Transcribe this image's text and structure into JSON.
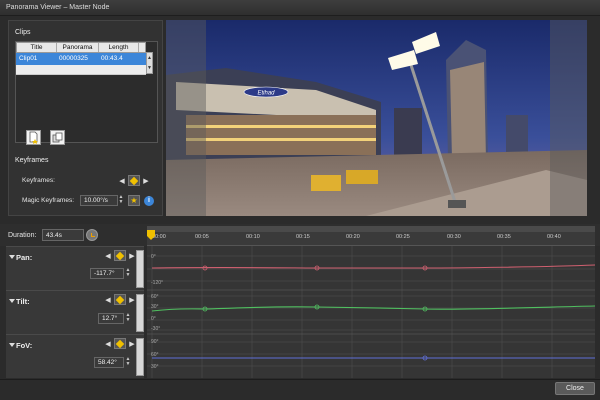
{
  "window": {
    "title": "Panorama Viewer – Master Node"
  },
  "clips": {
    "section_title": "Clips",
    "columns": [
      "Title",
      "Panorama",
      "Length"
    ],
    "rows": [
      {
        "title": "Clip01",
        "panorama": "00000325",
        "length": "00:43.4"
      }
    ]
  },
  "keyframes": {
    "section_title": "Keyframes",
    "keyframes_label": "Keyframes:",
    "magic_label": "Magic Keyframes:",
    "magic_value": "10.00°/s"
  },
  "timeline": {
    "duration_label": "Duration:",
    "duration_value": "43.4s",
    "ticks": [
      "00:00",
      "00:05",
      "00:10",
      "00:15",
      "00:20",
      "00:25",
      "00:30",
      "00:35",
      "00:40"
    ]
  },
  "tracks": [
    {
      "name": "Pan:",
      "value": "-117.7°",
      "axis": [
        "0°",
        "-120°"
      ],
      "color": "#d06070"
    },
    {
      "name": "Tilt:",
      "value": "12.7°",
      "axis": [
        "60°",
        "30°",
        "0°",
        "-30°"
      ],
      "color": "#50c060"
    },
    {
      "name": "FoV:",
      "value": "58.42°",
      "axis": [
        "90°",
        "60°",
        "30°"
      ],
      "color": "#6070d8"
    }
  ],
  "scene": {
    "sign_text": "Etihad"
  },
  "footer": {
    "close_label": "Close"
  }
}
